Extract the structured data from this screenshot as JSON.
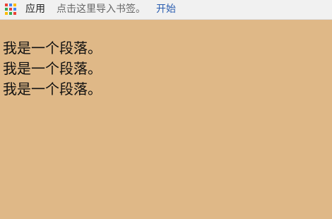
{
  "bookmarks_bar": {
    "apps_label": "应用",
    "import_hint": "点击这里导入书签。",
    "start_link": "开始",
    "apps_icon": "apps-grid-icon"
  },
  "page": {
    "background": "#dfb887",
    "paragraphs": [
      "我是一个段落。",
      "我是一个段落。",
      "我是一个段落。"
    ]
  }
}
